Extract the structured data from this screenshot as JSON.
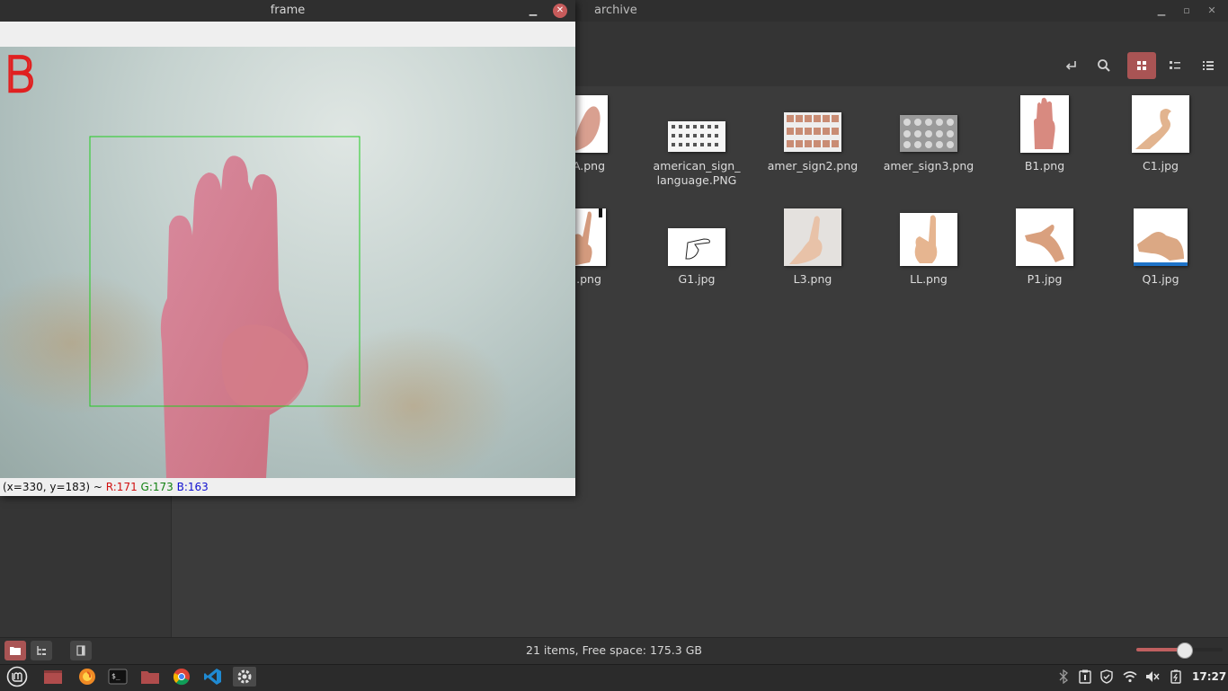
{
  "file_manager": {
    "title": "archive",
    "toolbar_icons": [
      "open-terminal-icon",
      "search-icon",
      "icon-view-icon",
      "compact-view-icon",
      "list-view-icon"
    ],
    "files": [
      {
        "name": "A.png"
      },
      {
        "name": "american_sign_\nlanguage.PNG"
      },
      {
        "name": "amer_sign2.png"
      },
      {
        "name": "amer_sign3.png"
      },
      {
        "name": "B1.png"
      },
      {
        "name": "C1.jpg"
      },
      {
        "name": ".png"
      },
      {
        "name": "G1.jpg"
      },
      {
        "name": "L3.png"
      },
      {
        "name": "LL.png"
      },
      {
        "name": "P1.jpg"
      },
      {
        "name": "Q1.jpg"
      }
    ],
    "status": "21 items, Free space: 175.3 GB",
    "zoom_level": 0.55,
    "accent_color": "#a95454"
  },
  "frame_window": {
    "title": "frame",
    "predicted_letter": "B",
    "status": {
      "coords": "(x=330, y=183) ~ ",
      "r": "R:171",
      "g": "G:173",
      "b": "B:163"
    },
    "roi_color": "#22cc22",
    "letter_color": "#e02020"
  },
  "taskbar": {
    "apps": [
      "mint-menu-icon",
      "show-desktop-icon",
      "firefox-icon",
      "terminal-icon",
      "files-icon",
      "chrome-icon",
      "vscode-icon",
      "python-app-icon"
    ],
    "tray": [
      "bluetooth-icon",
      "clipboard-icon",
      "shield-icon",
      "wifi-icon",
      "volume-muted-icon",
      "battery-icon"
    ],
    "clock": "17:27"
  }
}
